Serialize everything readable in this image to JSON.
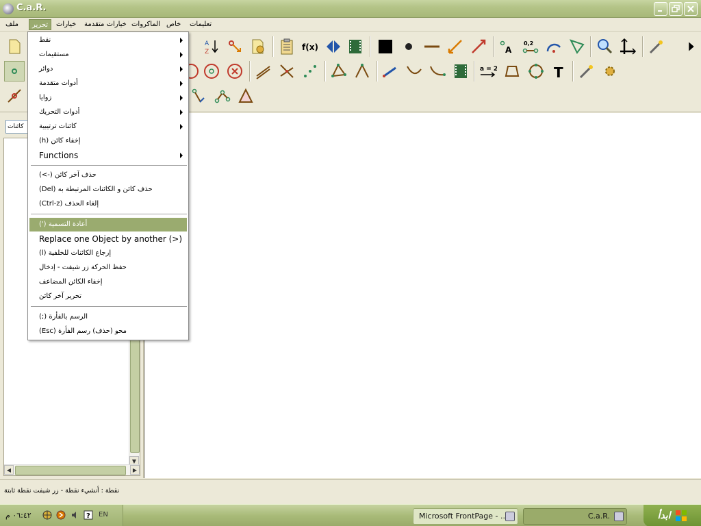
{
  "window": {
    "title": "C.a.R."
  },
  "menubar": {
    "items": [
      {
        "label": "ملف"
      },
      {
        "label": "تحرير"
      },
      {
        "label": "خيارات"
      },
      {
        "label": "خيارات متقدمة"
      },
      {
        "label": "الماكروات"
      },
      {
        "label": "خاص"
      },
      {
        "label": "تعليمات"
      }
    ]
  },
  "dropdown": {
    "items": [
      {
        "label": "نقط",
        "submenu": true
      },
      {
        "label": "مستقيمات",
        "submenu": true
      },
      {
        "label": "دوائر",
        "submenu": true
      },
      {
        "label": "أدوات متقدمة",
        "submenu": true
      },
      {
        "label": "زوايا",
        "submenu": true
      },
      {
        "label": "أدوات التحريك",
        "submenu": true
      },
      {
        "label": "كائنات ترتيبية",
        "submenu": true
      },
      {
        "label": "(h) إخفاء كائن",
        "submenu": false
      },
      {
        "label": "Functions",
        "submenu": true
      },
      {
        "label": "(<-)      حذف آخر كائن",
        "submenu": false
      },
      {
        "label": "(Del) حذف كائن و الكائنات المرتبطة به",
        "submenu": false
      },
      {
        "label": "(Ctrl-z)      إلغاء الحذف",
        "submenu": false
      },
      {
        "label": "(') أعادة التسمية",
        "submenu": false
      },
      {
        "label": "Replace one Object by another (>)",
        "submenu": false
      },
      {
        "label": "(l) إرجاع الكائنات للخلفية",
        "submenu": false
      },
      {
        "label": "حفظ الحركة زر شيفت - إدخال",
        "submenu": false
      },
      {
        "label": "إخفاء الكائن المضاعف",
        "submenu": false
      },
      {
        "label": "تحرير آخر كائن",
        "submenu": false
      },
      {
        "label": "(;) الرسم بالفأرة",
        "submenu": false
      },
      {
        "label": "(Esc)      محو (حذف) رسم الفأرة",
        "submenu": false
      }
    ]
  },
  "leftpanel": {
    "combo_value": "كائنات"
  },
  "toolbar": {
    "row1": [
      "paper-icon",
      "sort-az-icon",
      "point-arrow-icon",
      "settings-doc-icon",
      "clipboard-icon",
      "fx-icon",
      "mirror-icon",
      "film-icon",
      "black-square-icon",
      "dot-icon",
      "line-segment-icon",
      "double-arrow-icon",
      "arrow-icon",
      "label-a-icon",
      "value-icon",
      "arc-icon",
      "angle-icon",
      "zoom-icon",
      "axes-icon",
      "wand-icon",
      "more-arrow-icon"
    ],
    "row2": [
      "point-tool-icon",
      "circle-tool-icon",
      "circle-center-icon",
      "circle-x-icon",
      "parallel-icon",
      "intersect-icon",
      "points-icon",
      "polygon-points-icon",
      "angle-points-icon",
      "ray-icon",
      "curve-icon",
      "curve2-icon",
      "film2-icon",
      "equation-icon",
      "quad-icon",
      "circle-dots-icon",
      "text-icon",
      "wand2-icon",
      "gear-icon"
    ],
    "row3": [
      "line-point-icon",
      "tree-icon",
      "chain-icon",
      "triangle-icon"
    ],
    "fx_label": "f(x)",
    "eq_label": "a = 2",
    "text_label": "T",
    "val_label": "0,2",
    "a_label": "A"
  },
  "status": {
    "text": "نقطة : أنشيء نقطة - زر شيفت نقطة ثابتة"
  },
  "taskbar": {
    "start_label": "ابدأ",
    "tasks": [
      {
        "label": "C.a.R."
      },
      {
        "label": "Microsoft FrontPage - ..."
      }
    ],
    "clock": "٠٦:٤٢ م",
    "lang": "EN"
  },
  "colors": {
    "accent": "#9aab6f",
    "taskbar": "#a9bb79",
    "icon_red": "#c0392b",
    "icon_green": "#2e8b57",
    "icon_blue": "#2255aa"
  }
}
